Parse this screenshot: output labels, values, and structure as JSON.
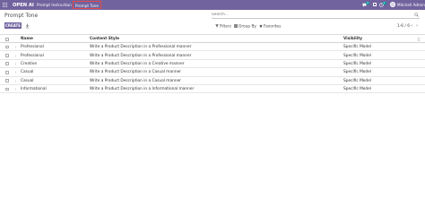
{
  "navbar": {
    "app_name": "OPEN AI",
    "menus": [
      "Prompt Instruction",
      "Prompt Tone"
    ],
    "chat_count": "4",
    "activity_count": "1",
    "username": "Mitchell Admin",
    "icons": [
      "apps-grid-icon",
      "chat-icon",
      "clock-icon",
      "company-icon",
      "avatar"
    ]
  },
  "page": {
    "title": "Prompt Tone"
  },
  "search": {
    "placeholder": "Search..."
  },
  "controls": {
    "create_label": "CREATE",
    "filters_label": "Filters",
    "group_by_label": "Group By",
    "favorites_label": "Favorites",
    "pager": "1-6 / 6"
  },
  "table": {
    "columns": [
      "Name",
      "Content Style",
      "Visibility"
    ],
    "rows": [
      {
        "name": "Professional",
        "content_style": "Write a Product Description in a Professional manner",
        "visibility": "Specific Model"
      },
      {
        "name": "Professional",
        "content_style": "Write a Product Description in a Professional manner",
        "visibility": "Specific Model"
      },
      {
        "name": "Creative",
        "content_style": "Write a Product Description in a Creative manner",
        "visibility": "Specific Model"
      },
      {
        "name": "Casual",
        "content_style": "Write a Product Description in a Casual manner",
        "visibility": "Specific Model"
      },
      {
        "name": "Casual",
        "content_style": "Write a Product Description in a Casual manner",
        "visibility": "Specific Model"
      },
      {
        "name": "Informational",
        "content_style": "Write a Product Description in a Informational manner",
        "visibility": "Specific Model"
      }
    ]
  },
  "colors": {
    "brand": "#71639e",
    "badge": "#00a09d",
    "highlight_outline": "#e24a4a"
  }
}
